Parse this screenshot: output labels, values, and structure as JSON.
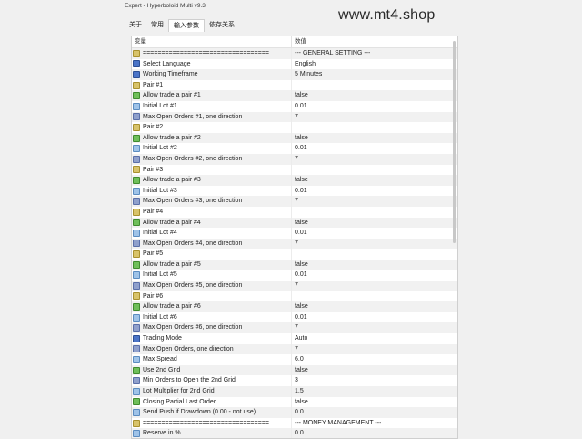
{
  "window": {
    "title": "Expert - Hyperboloid Multi v9.3"
  },
  "watermark": "www.mt4.shop",
  "tabs": [
    "关于",
    "常用",
    "输入参数",
    "依存关系"
  ],
  "table": {
    "headers": {
      "name": "变量",
      "value": "数值"
    },
    "rows": [
      {
        "icon": "ab",
        "name": "==================================",
        "value": "--- GENERAL SETTING ---"
      },
      {
        "icon": "ab2",
        "name": "Select Language",
        "value": "English"
      },
      {
        "icon": "ab2",
        "name": "Working Timeframe",
        "value": "5 Minutes"
      },
      {
        "icon": "ab",
        "name": "Pair #1",
        "value": ""
      },
      {
        "icon": "sw",
        "name": "Allow trade a pair #1",
        "value": "false"
      },
      {
        "icon": "v2",
        "name": "Initial Lot #1",
        "value": "0.01"
      },
      {
        "icon": "d",
        "name": "Max Open Orders #1, one direction",
        "value": "7"
      },
      {
        "icon": "ab",
        "name": "Pair #2",
        "value": ""
      },
      {
        "icon": "sw",
        "name": "Allow trade a pair #2",
        "value": "false"
      },
      {
        "icon": "v2",
        "name": "Initial Lot #2",
        "value": "0.01"
      },
      {
        "icon": "d",
        "name": "Max Open Orders #2, one direction",
        "value": "7"
      },
      {
        "icon": "ab",
        "name": "Pair #3",
        "value": ""
      },
      {
        "icon": "sw",
        "name": "Allow trade a pair #3",
        "value": "false"
      },
      {
        "icon": "v2",
        "name": "Initial Lot #3",
        "value": "0.01"
      },
      {
        "icon": "d",
        "name": "Max Open Orders #3, one direction",
        "value": "7"
      },
      {
        "icon": "ab",
        "name": "Pair #4",
        "value": ""
      },
      {
        "icon": "sw",
        "name": "Allow trade a pair #4",
        "value": "false"
      },
      {
        "icon": "v2",
        "name": "Initial Lot #4",
        "value": "0.01"
      },
      {
        "icon": "d",
        "name": "Max Open Orders #4, one direction",
        "value": "7"
      },
      {
        "icon": "ab",
        "name": "Pair #5",
        "value": ""
      },
      {
        "icon": "sw",
        "name": "Allow trade a pair #5",
        "value": "false"
      },
      {
        "icon": "v2",
        "name": "Initial Lot #5",
        "value": "0.01"
      },
      {
        "icon": "d",
        "name": "Max Open Orders #5, one direction",
        "value": "7"
      },
      {
        "icon": "ab",
        "name": "Pair #6",
        "value": ""
      },
      {
        "icon": "sw",
        "name": "Allow trade a pair #6",
        "value": "false"
      },
      {
        "icon": "v2",
        "name": "Initial Lot #6",
        "value": "0.01"
      },
      {
        "icon": "d",
        "name": "Max Open Orders #6, one direction",
        "value": "7"
      },
      {
        "icon": "ab2",
        "name": "Trading Mode",
        "value": "Auto"
      },
      {
        "icon": "d",
        "name": "Max Open Orders, one direction",
        "value": "7"
      },
      {
        "icon": "v2",
        "name": "Max Spread",
        "value": "6.0"
      },
      {
        "icon": "sw",
        "name": "Use 2nd Grid",
        "value": "false"
      },
      {
        "icon": "d",
        "name": "Min Orders to Open the 2nd Grid",
        "value": "3"
      },
      {
        "icon": "v2",
        "name": "Lot Multiplier for 2nd Grid",
        "value": "1.5"
      },
      {
        "icon": "sw",
        "name": "Closing Partial Last Order",
        "value": "false"
      },
      {
        "icon": "v2",
        "name": "Send Push if Drawdown (0.00 - not use)",
        "value": "0.0"
      },
      {
        "icon": "ab",
        "name": "==================================",
        "value": "--- MONEY MANAGEMENT ---"
      },
      {
        "icon": "v2",
        "name": "Reserve in %",
        "value": "0.0"
      }
    ]
  },
  "colors": {
    "row_alt": "#f1f1f1",
    "panel_bg": "#ffffff",
    "window_bg": "#f0f0f0"
  }
}
